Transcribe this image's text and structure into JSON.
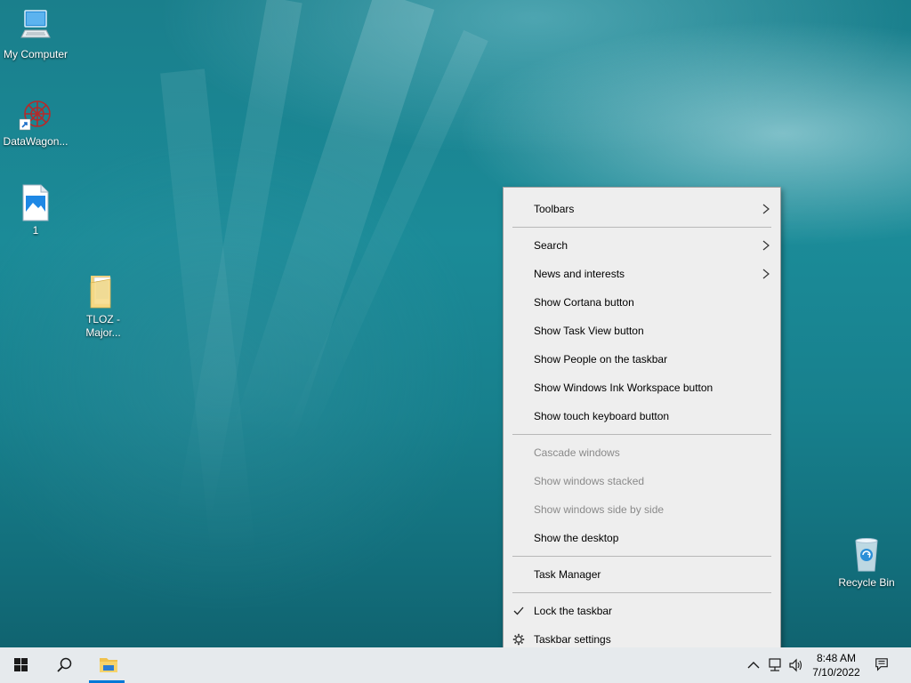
{
  "desktop": {
    "icons": [
      {
        "label": "My Computer"
      },
      {
        "label": "DataWagon..."
      },
      {
        "label": "1"
      },
      {
        "label_line1": "TLOZ -",
        "label_line2": "Major..."
      },
      {
        "label": "Recycle Bin"
      }
    ]
  },
  "context_menu": {
    "items": [
      {
        "label": "Toolbars",
        "submenu": true
      },
      {
        "label": "Search",
        "submenu": true
      },
      {
        "label": "News and interests",
        "submenu": true
      },
      {
        "label": "Show Cortana button"
      },
      {
        "label": "Show Task View button"
      },
      {
        "label": "Show People on the taskbar"
      },
      {
        "label": "Show Windows Ink Workspace button"
      },
      {
        "label": "Show touch keyboard button"
      },
      {
        "label": "Cascade windows",
        "disabled": true
      },
      {
        "label": "Show windows stacked",
        "disabled": true
      },
      {
        "label": "Show windows side by side",
        "disabled": true
      },
      {
        "label": "Show the desktop"
      },
      {
        "label": "Task Manager"
      },
      {
        "label": "Lock the taskbar",
        "checked": true
      },
      {
        "label": "Taskbar settings",
        "icon": "gear-icon"
      }
    ]
  },
  "taskbar": {
    "clock": {
      "time": "8:48 AM",
      "date": "7/10/2022"
    },
    "icons": [
      "windows-start-icon",
      "search-icon",
      "file-explorer-icon",
      "chevron-up-icon",
      "network-icon",
      "volume-icon",
      "notifications-icon"
    ]
  },
  "colors": {
    "taskbar_bg": "#e6eaed",
    "menu_bg": "#eeeeee",
    "disabled_text": "#8a8a8a",
    "active_indicator": "#0078d7"
  }
}
